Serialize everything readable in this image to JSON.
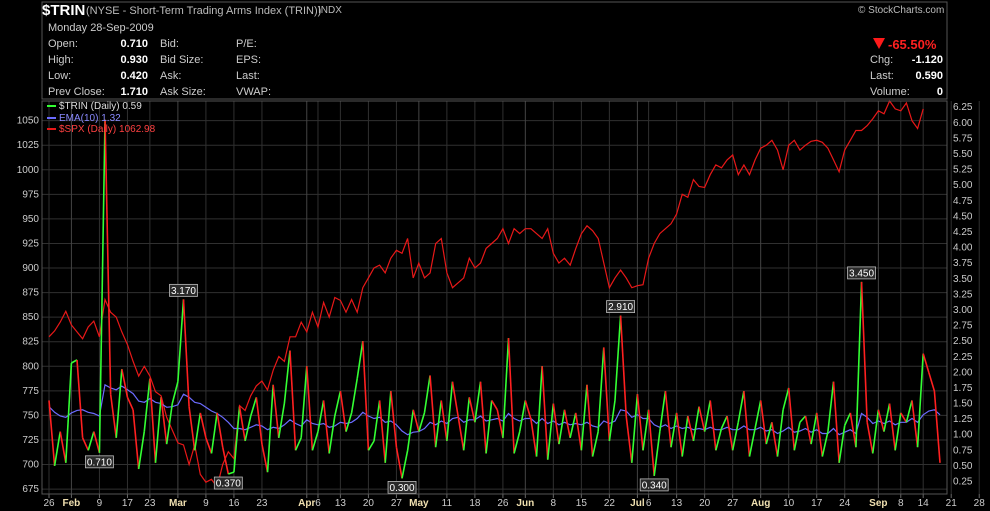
{
  "header": {
    "symbol": "$TRIN",
    "name": "(NYSE - Short-Term Trading Arms Index (TRIN))",
    "exchange": "INDX",
    "brand": "© StockCharts.com",
    "date": "Monday  28-Sep-2009",
    "quote_left": [
      {
        "label": "Open:",
        "value": "0.710"
      },
      {
        "label": "High:",
        "value": "0.930"
      },
      {
        "label": "Low:",
        "value": "0.420"
      },
      {
        "label": "Prev Close:",
        "value": "1.710"
      }
    ],
    "quote_mid": [
      "Bid:",
      "Bid Size:",
      "Ask:",
      "Ask Size:"
    ],
    "quote_mid2": [
      "P/E:",
      "EPS:",
      "Last:",
      "VWAP:"
    ],
    "change_pct": "-65.50%",
    "quote_right": [
      {
        "label": "Chg:",
        "value": "-1.120"
      },
      {
        "label": "Last:",
        "value": "0.590"
      },
      {
        "label": "Volume:",
        "value": "0"
      }
    ]
  },
  "colors": {
    "trin_up": "#33ff33",
    "trin_down": "#ff2020",
    "ema": "#6b6bff",
    "spx": "#e81818",
    "grid": "#303030",
    "background": "#000000"
  },
  "chart_data": {
    "type": "line",
    "legend_placement": "top-left",
    "grid": true,
    "left_axis": {
      "ylim": [
        670,
        1070
      ],
      "ticks": [
        675,
        700,
        725,
        750,
        775,
        800,
        825,
        850,
        875,
        900,
        925,
        950,
        975,
        1000,
        1025,
        1050
      ]
    },
    "right_axis": {
      "ylim": [
        0.05,
        6.35
      ],
      "ticks": [
        "0.25",
        "0.50",
        "0.75",
        "1.00",
        "1.25",
        "1.50",
        "1.75",
        "2.00",
        "2.25",
        "2.50",
        "2.75",
        "3.00",
        "3.25",
        "3.50",
        "3.75",
        "4.00",
        "4.25",
        "4.50",
        "4.75",
        "5.00",
        "5.25",
        "5.50",
        "5.75",
        "6.00",
        "6.25"
      ]
    },
    "x_ticks": [
      {
        "label": "26",
        "i": 0
      },
      {
        "label": "Feb",
        "i": 4,
        "major": true
      },
      {
        "label": "9",
        "i": 9
      },
      {
        "label": "17",
        "i": 14
      },
      {
        "label": "23",
        "i": 18
      },
      {
        "label": "Mar",
        "i": 23,
        "major": true
      },
      {
        "label": "9",
        "i": 28
      },
      {
        "label": "16",
        "i": 33
      },
      {
        "label": "23",
        "i": 38
      },
      {
        "label": "Apr",
        "i": 46,
        "major": true
      },
      {
        "label": "6",
        "i": 48
      },
      {
        "label": "13",
        "i": 52
      },
      {
        "label": "20",
        "i": 57
      },
      {
        "label": "27",
        "i": 62
      },
      {
        "label": "May",
        "i": 66,
        "major": true
      },
      {
        "label": "11",
        "i": 71
      },
      {
        "label": "18",
        "i": 76
      },
      {
        "label": "26",
        "i": 81
      },
      {
        "label": "Jun",
        "i": 85,
        "major": true
      },
      {
        "label": "8",
        "i": 90
      },
      {
        "label": "15",
        "i": 95
      },
      {
        "label": "22",
        "i": 100
      },
      {
        "label": "Jul",
        "i": 105,
        "major": true
      },
      {
        "label": "6",
        "i": 107
      },
      {
        "label": "13",
        "i": 112
      },
      {
        "label": "20",
        "i": 117
      },
      {
        "label": "27",
        "i": 122
      },
      {
        "label": "Aug",
        "i": 127,
        "major": true
      },
      {
        "label": "10",
        "i": 132
      },
      {
        "label": "17",
        "i": 137
      },
      {
        "label": "24",
        "i": 142
      },
      {
        "label": "Sep",
        "i": 148,
        "major": true
      },
      {
        "label": "8",
        "i": 152
      },
      {
        "label": "14",
        "i": 156
      },
      {
        "label": "21",
        "i": 161
      },
      {
        "label": "28",
        "i": 166
      }
    ],
    "series": [
      {
        "name": "$TRIN (Daily) 0.59",
        "axis": "right",
        "values": [
          1.55,
          0.5,
          1.05,
          0.55,
          2.15,
          2.2,
          0.95,
          0.75,
          1.05,
          0.71,
          6.05,
          1.65,
          0.95,
          2.05,
          1.6,
          1.4,
          0.45,
          1.05,
          1.9,
          0.55,
          1.6,
          0.85,
          1.5,
          1.85,
          3.17,
          1.45,
          0.75,
          1.35,
          0.95,
          0.7,
          1.35,
          0.8,
          0.37,
          0.4,
          1.45,
          0.9,
          1.3,
          1.6,
          0.85,
          0.4,
          1.8,
          0.95,
          1.5,
          2.35,
          0.75,
          0.95,
          2.1,
          0.75,
          1.05,
          1.55,
          0.7,
          1.3,
          1.7,
          1.05,
          1.35,
          1.9,
          2.5,
          0.75,
          0.9,
          1.55,
          0.55,
          1.7,
          0.8,
          0.3,
          0.75,
          1.4,
          1.05,
          1.35,
          1.95,
          0.8,
          1.55,
          0.9,
          1.85,
          1.3,
          0.75,
          1.6,
          1.2,
          1.85,
          0.7,
          1.55,
          1.4,
          0.95,
          2.55,
          0.7,
          1.05,
          1.55,
          1.25,
          0.65,
          2.1,
          0.6,
          1.5,
          0.85,
          1.4,
          0.95,
          1.35,
          0.75,
          1.8,
          0.65,
          1.05,
          2.4,
          0.9,
          1.55,
          2.91,
          1.3,
          0.55,
          1.65,
          0.75,
          1.4,
          0.34,
          1.05,
          1.7,
          0.8,
          1.35,
          0.65,
          1.3,
          0.9,
          1.45,
          1.05,
          1.55,
          0.75,
          1.1,
          1.3,
          0.75,
          1.2,
          1.7,
          0.65,
          1.1,
          1.55,
          0.85,
          1.2,
          0.65,
          1.4,
          1.75,
          0.75,
          1.2,
          1.3,
          0.85,
          1.35,
          0.65,
          1.05,
          1.85,
          0.55,
          1.15,
          1.35,
          0.8,
          3.45,
          1.2,
          0.7,
          1.4,
          1.05,
          1.5,
          0.75,
          1.35,
          1.2,
          1.55,
          0.8,
          2.3,
          2.0,
          1.7,
          0.55
        ]
      },
      {
        "name": "EMA(10) 1.32",
        "axis": "right",
        "values": [
          1.45,
          1.36,
          1.3,
          1.28,
          1.35,
          1.39,
          1.4,
          1.36,
          1.34,
          1.3,
          1.8,
          1.75,
          1.72,
          1.78,
          1.72,
          1.66,
          1.54,
          1.52,
          1.58,
          1.52,
          1.5,
          1.44,
          1.45,
          1.48,
          1.65,
          1.6,
          1.52,
          1.5,
          1.44,
          1.38,
          1.34,
          1.28,
          1.2,
          1.1,
          1.1,
          1.08,
          1.12,
          1.16,
          1.14,
          1.08,
          1.12,
          1.1,
          1.16,
          1.24,
          1.18,
          1.14,
          1.24,
          1.18,
          1.16,
          1.18,
          1.12,
          1.14,
          1.2,
          1.18,
          1.2,
          1.26,
          1.36,
          1.3,
          1.26,
          1.28,
          1.2,
          1.22,
          1.16,
          1.06,
          1.0,
          1.04,
          1.05,
          1.1,
          1.2,
          1.16,
          1.22,
          1.18,
          1.26,
          1.28,
          1.2,
          1.24,
          1.24,
          1.3,
          1.22,
          1.24,
          1.26,
          1.22,
          1.34,
          1.26,
          1.22,
          1.26,
          1.26,
          1.18,
          1.26,
          1.18,
          1.22,
          1.16,
          1.2,
          1.16,
          1.18,
          1.16,
          1.2,
          1.14,
          1.12,
          1.22,
          1.18,
          1.22,
          1.4,
          1.38,
          1.28,
          1.32,
          1.26,
          1.26,
          1.16,
          1.12,
          1.16,
          1.1,
          1.14,
          1.1,
          1.12,
          1.08,
          1.1,
          1.08,
          1.12,
          1.08,
          1.08,
          1.12,
          1.08,
          1.08,
          1.14,
          1.08,
          1.08,
          1.12,
          1.06,
          1.08,
          1.02,
          1.06,
          1.12,
          1.04,
          1.06,
          1.1,
          1.04,
          1.08,
          1.02,
          1.02,
          1.1,
          1.0,
          1.04,
          1.08,
          1.02,
          1.34,
          1.28,
          1.18,
          1.22,
          1.18,
          1.22,
          1.16,
          1.2,
          1.2,
          1.26,
          1.2,
          1.32,
          1.38,
          1.4,
          1.32
        ]
      },
      {
        "name": "$SPX (Daily) 1062.98",
        "axis": "left",
        "values": [
          830,
          836,
          845,
          856,
          842,
          835,
          828,
          840,
          846,
          830,
          868,
          855,
          850,
          835,
          822,
          805,
          790,
          800,
          790,
          774,
          770,
          748,
          735,
          722,
          720,
          700,
          720,
          690,
          682,
          685,
          677,
          700,
          713,
          706,
          760,
          755,
          770,
          780,
          785,
          776,
          796,
          810,
          805,
          830,
          830,
          845,
          835,
          855,
          840,
          865,
          850,
          870,
          867,
          855,
          868,
          855,
          880,
          890,
          900,
          903,
          895,
          910,
          918,
          915,
          930,
          890,
          905,
          890,
          895,
          925,
          930,
          895,
          880,
          885,
          890,
          910,
          900,
          905,
          920,
          925,
          930,
          940,
          925,
          940,
          935,
          940,
          940,
          935,
          930,
          940,
          915,
          905,
          910,
          903,
          920,
          935,
          943,
          938,
          930,
          905,
          880,
          890,
          898,
          890,
          880,
          882,
          883,
          910,
          925,
          935,
          940,
          945,
          955,
          975,
          972,
          990,
          983,
          982,
          995,
          1005,
          1002,
          1010,
          1015,
          995,
          1005,
          995,
          1010,
          1022,
          1025,
          1030,
          1020,
          1000,
          1025,
          1030,
          1020,
          1025,
          1029,
          1030,
          1028,
          1022,
          1010,
          998,
          1020,
          1030,
          1040,
          1040,
          1045,
          1052,
          1060,
          1057,
          1070,
          1062,
          1060,
          1068,
          1050,
          1042,
          1062
        ]
      }
    ],
    "annotations": [
      {
        "series": 0,
        "i": 9,
        "text": "0.710",
        "pos": "below"
      },
      {
        "series": 0,
        "i": 24,
        "text": "3.170",
        "pos": "above"
      },
      {
        "series": 0,
        "i": 32,
        "text": "0.370",
        "pos": "below"
      },
      {
        "series": 0,
        "i": 63,
        "text": "0.300",
        "pos": "below"
      },
      {
        "series": 0,
        "i": 102,
        "text": "2.910",
        "pos": "above"
      },
      {
        "series": 0,
        "i": 108,
        "text": "0.340",
        "pos": "below"
      },
      {
        "series": 0,
        "i": 145,
        "text": "3.450",
        "pos": "above"
      }
    ]
  }
}
